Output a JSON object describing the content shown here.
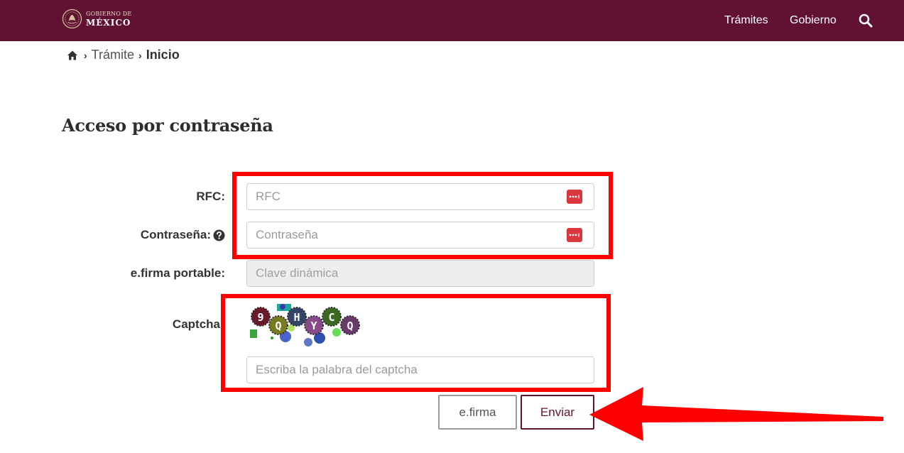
{
  "header": {
    "logo_line1": "GOBIERNO DE",
    "logo_line2": "MÉXICO",
    "nav": [
      "Trámites",
      "Gobierno"
    ],
    "search_icon": "search-icon",
    "background_color": "#611232"
  },
  "breadcrumb": {
    "home_icon": "home-icon",
    "items": [
      "Trámite",
      "Inicio"
    ]
  },
  "page_title": "Acceso por contraseña",
  "form": {
    "rfc": {
      "label": "RFC:",
      "placeholder": "RFC",
      "icon": "password-dots-icon"
    },
    "password": {
      "label": "Contraseña:",
      "placeholder": "Contraseña",
      "icon": "password-dots-icon",
      "help_icon": "question-circle-icon"
    },
    "efirma_portable": {
      "label": "e.firma portable:",
      "placeholder": "Clave dinámica",
      "disabled": true
    },
    "captcha": {
      "label": "Captcha",
      "placeholder": "Escriba la palabra del captcha",
      "image_text": "9QHYCQ"
    }
  },
  "buttons": {
    "efirma": "e.firma",
    "enviar": "Enviar"
  },
  "annotations": {
    "color": "#ff0000"
  }
}
